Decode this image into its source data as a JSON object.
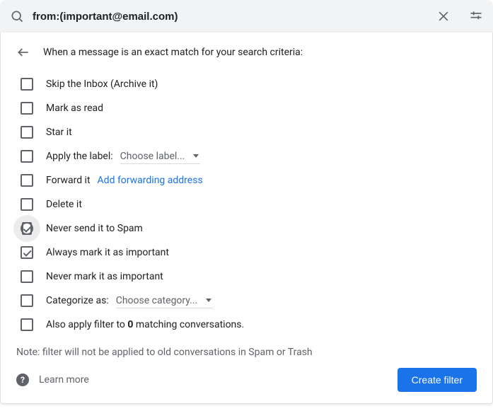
{
  "search": {
    "value": "from:(important@email.com)"
  },
  "header": {
    "title": "When a message is an exact match for your search criteria:"
  },
  "options": {
    "skip_inbox": {
      "label": "Skip the Inbox (Archive it)",
      "checked": false
    },
    "mark_read": {
      "label": "Mark as read",
      "checked": false
    },
    "star": {
      "label": "Star it",
      "checked": false
    },
    "apply_label": {
      "label": "Apply the label:",
      "checked": false,
      "select": "Choose label..."
    },
    "forward": {
      "label": "Forward it",
      "checked": false,
      "link": "Add forwarding address"
    },
    "delete": {
      "label": "Delete it",
      "checked": false
    },
    "never_spam": {
      "label": "Never send it to Spam",
      "checked": true,
      "highlight": true
    },
    "always_important": {
      "label": "Always mark it as important",
      "checked": true
    },
    "never_important": {
      "label": "Never mark it as important",
      "checked": false
    },
    "categorize": {
      "label": "Categorize as:",
      "checked": false,
      "select": "Choose category..."
    },
    "also_apply": {
      "label_pre": "Also apply filter to ",
      "matching_count": "0",
      "label_post": " matching conversations.",
      "checked": false
    }
  },
  "note": "Note: filter will not be applied to old conversations in Spam or Trash",
  "footer": {
    "learn_more": "Learn more",
    "create": "Create filter"
  }
}
